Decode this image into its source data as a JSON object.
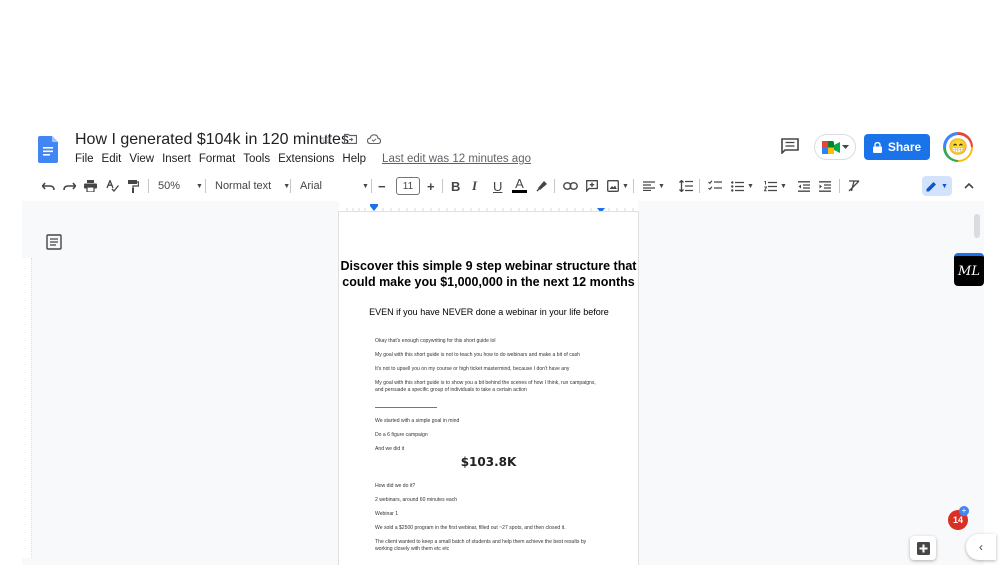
{
  "document": {
    "title": "How I generated $104k in 120 minutes",
    "last_edit": "Last edit was 12 minutes ago"
  },
  "menu": [
    "File",
    "Edit",
    "View",
    "Insert",
    "Format",
    "Tools",
    "Extensions",
    "Help"
  ],
  "header": {
    "share_label": "Share",
    "avatar_emoji": "😁"
  },
  "toolbar": {
    "zoom": "50%",
    "style": "Normal text",
    "font": "Arial",
    "font_size": "11",
    "minus": "−",
    "plus": "+",
    "bold": "B",
    "italic": "I",
    "underline": "U",
    "text_color": "A"
  },
  "page": {
    "heading": "Discover this simple 9 step webinar structure that could make you $1,000,000 in the next 12 months",
    "subheading": "EVEN if you have NEVER done a webinar in your life before",
    "paragraphs": [
      "Okay that's enough copywriting for this short guide lol",
      "My goal with this short guide is not to teach you how to do webinars and make a bit of cash",
      "It's not to upsell you on my course or high ticket mastermind, because I don't have any",
      "My goal with this short guide is to show you a bit behind the scenes of how I think, run campaigns, and persuade a specific group of individuals to take a certain action"
    ],
    "divider": "_______________________",
    "paragraphs2": [
      "We started with a simple goal in mind",
      "Do a 6 figure campaign",
      "And we did it"
    ],
    "big_figure": "$103.8K",
    "paragraphs3": [
      "How did we do it?",
      "2 webinars, around 60 minutes each",
      "Webinar 1",
      "We sold a $2500 program in the first webinar, filled out ~27 spots, and then closed it.",
      "The client wanted to keep a small batch of students and help them achieve the best results by working closely with them etc etc"
    ]
  },
  "side": {
    "extension_label": "ML",
    "notification_count": "14"
  },
  "colors": {
    "accent": "#1a73e8",
    "canvas": "#f8f9fa"
  }
}
